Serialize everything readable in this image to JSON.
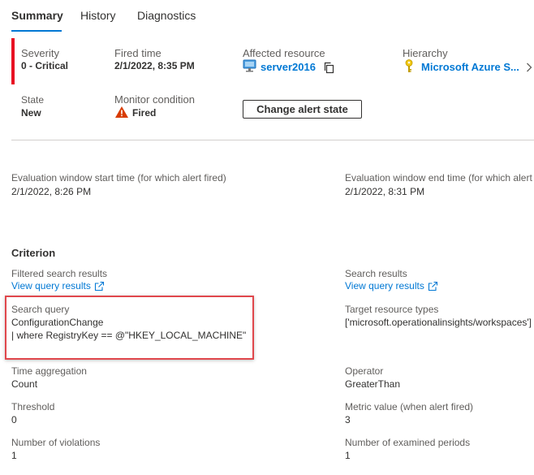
{
  "tabs": [
    "Summary",
    "History",
    "Diagnostics"
  ],
  "summary": {
    "severity": {
      "label": "Severity",
      "value": "0 - Critical"
    },
    "fired_time": {
      "label": "Fired time",
      "value": "2/1/2022, 8:35 PM"
    },
    "affected_resource": {
      "label": "Affected resource",
      "value": "server2016"
    },
    "hierarchy": {
      "label": "Hierarchy",
      "value": "Microsoft Azure S..."
    },
    "state": {
      "label": "State",
      "value": "New"
    },
    "monitor_condition": {
      "label": "Monitor condition",
      "value": "Fired"
    },
    "change_state_label": "Change alert state"
  },
  "evaluation": {
    "start_label": "Evaluation window start time (for which alert fired)",
    "start_value": "2/1/2022, 8:26 PM",
    "end_label": "Evaluation window end time (for which alert",
    "end_value": "2/1/2022, 8:31 PM"
  },
  "criterion": {
    "heading": "Criterion",
    "filtered_label": "Filtered search results",
    "filtered_link": "View query results",
    "search_results_label": "Search results",
    "search_results_link": "View query results",
    "search_query_label": "Search query",
    "search_query_line1": "ConfigurationChange",
    "search_query_line2": "| where RegistryKey == @\"HKEY_LOCAL_MACHINE\"",
    "target_label": "Target resource types",
    "target_value": "['microsoft.operationalinsights/workspaces']",
    "time_agg_label": "Time aggregation",
    "time_agg_value": "Count",
    "operator_label": "Operator",
    "operator_value": "GreaterThan",
    "threshold_label": "Threshold",
    "threshold_value": "0",
    "metric_label": "Metric value (when alert fired)",
    "metric_value": "3",
    "violations_label": "Number of violations",
    "violations_value": "1",
    "examined_label": "Number of examined periods",
    "examined_value": "1"
  },
  "colors": {
    "accent": "#0078d4",
    "critical": "#e81123",
    "warning": "#d83b01",
    "highlight_border": "#e0474c"
  },
  "icons": {
    "resource": "vm-monitor-icon",
    "copy": "copy-icon",
    "hierarchy": "key-icon",
    "chevron": "chevron-right-icon",
    "warning": "warning-icon",
    "external": "external-link-icon"
  }
}
